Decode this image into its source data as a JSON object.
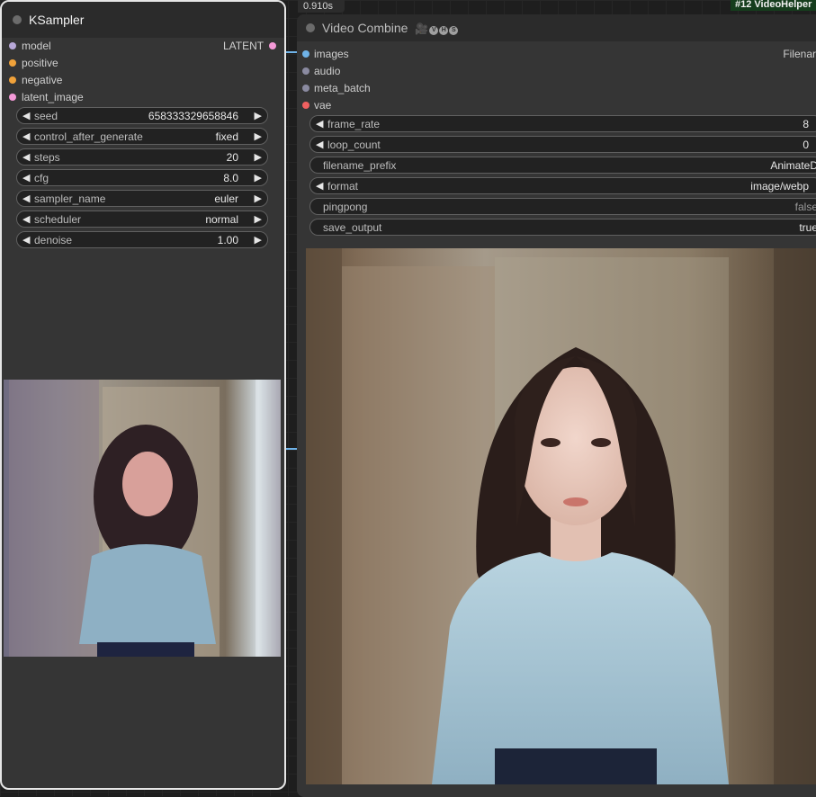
{
  "timing": "0.910s",
  "top_node_title": "#12 VideoHelper",
  "ksampler": {
    "title": "KSampler",
    "inputs": [
      {
        "label": "model",
        "color": "#b8a8d8"
      },
      {
        "label": "positive",
        "color": "#f0a23a"
      },
      {
        "label": "negative",
        "color": "#f0a23a"
      },
      {
        "label": "latent_image",
        "color": "#f59ad8"
      }
    ],
    "output": {
      "label": "LATENT",
      "color": "#f59ad8"
    },
    "widgets": [
      {
        "label": "seed",
        "value": "658333329658846"
      },
      {
        "label": "control_after_generate",
        "value": "fixed"
      },
      {
        "label": "steps",
        "value": "20"
      },
      {
        "label": "cfg",
        "value": "8.0"
      },
      {
        "label": "sampler_name",
        "value": "euler"
      },
      {
        "label": "scheduler",
        "value": "normal"
      },
      {
        "label": "denoise",
        "value": "1.00"
      }
    ]
  },
  "video_combine": {
    "title": "Video Combine",
    "badge_icon": "film-icon",
    "badge_letters": [
      "V",
      "H",
      "S"
    ],
    "inputs": [
      {
        "label": "images",
        "color": "#6fb3e8"
      },
      {
        "label": "audio",
        "color": "#8a8aa0"
      },
      {
        "label": "meta_batch",
        "color": "#8a8aa0"
      },
      {
        "label": "vae",
        "color": "#f06060"
      }
    ],
    "output_label": "Filenar",
    "widgets": [
      {
        "label": "frame_rate",
        "value": "8",
        "arrows": true
      },
      {
        "label": "loop_count",
        "value": "0",
        "arrows": true
      },
      {
        "label": "filename_prefix",
        "value": "AnimateD",
        "arrows": false
      },
      {
        "label": "format",
        "value": "image/webp",
        "arrows": true
      },
      {
        "label": "pingpong",
        "value": "false",
        "arrows": false
      },
      {
        "label": "save_output",
        "value": "true",
        "arrows": false
      }
    ]
  }
}
